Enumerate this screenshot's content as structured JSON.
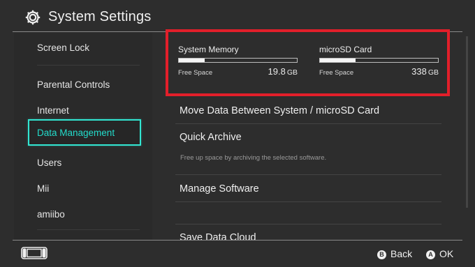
{
  "header": {
    "title": "System Settings",
    "icon": "gear-icon"
  },
  "sidebar": {
    "items": [
      {
        "label": "Screen Lock"
      },
      {
        "label": "Parental Controls"
      },
      {
        "label": "Internet"
      },
      {
        "label": "Data Management",
        "selected": true
      },
      {
        "label": "Users"
      },
      {
        "label": "Mii"
      },
      {
        "label": "amiibo"
      }
    ]
  },
  "storage": {
    "system": {
      "name": "System Memory",
      "free_label": "Free Space",
      "free_value": "19.8",
      "unit": "GB",
      "used_fraction": 0.22
    },
    "sd": {
      "name": "microSD Card",
      "free_label": "Free Space",
      "free_value": "338",
      "unit": "GB",
      "used_fraction": 0.3
    },
    "highlight_color": "#e21f2a"
  },
  "menu": {
    "move_data": "Move Data Between System / microSD Card",
    "quick_archive": "Quick Archive",
    "quick_archive_desc": "Free up space by archiving the selected software.",
    "manage_software": "Manage Software",
    "save_data_cloud": "Save Data Cloud"
  },
  "footer": {
    "back_button": "B",
    "back_label": "Back",
    "ok_button": "A",
    "ok_label": "OK"
  },
  "colors": {
    "accent": "#32e6d2",
    "background": "#2d2d2d"
  }
}
